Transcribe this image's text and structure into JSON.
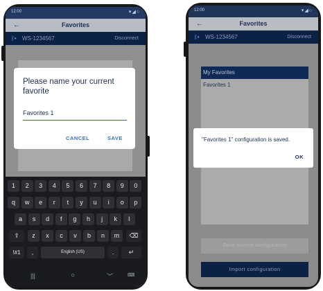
{
  "status": {
    "time": "12:00",
    "icons": "▾◢○"
  },
  "left": {
    "title": "Favorites",
    "device_id": "WS-1234567",
    "disconnect": "Disconnect",
    "dialog": {
      "title": "Please name your current favorite",
      "input_value": "Favorites 1",
      "cancel": "CANCEL",
      "save": "SAVE"
    },
    "keyboard": {
      "numbers": [
        "1",
        "2",
        "3",
        "4",
        "5",
        "6",
        "7",
        "8",
        "9",
        "0"
      ],
      "row1": [
        "q",
        "w",
        "e",
        "r",
        "t",
        "y",
        "u",
        "i",
        "o",
        "p"
      ],
      "row2": [
        "a",
        "s",
        "d",
        "f",
        "g",
        "h",
        "j",
        "k",
        "l"
      ],
      "row3": [
        "z",
        "x",
        "c",
        "v",
        "b",
        "n",
        "m"
      ],
      "symbols": "!#1",
      "comma": ",",
      "space": "English (US)",
      "period": "."
    }
  },
  "right": {
    "title": "Favorites",
    "device_id": "WS-1234567",
    "disconnect": "Disconnect",
    "list_header": "My Favorites",
    "list_item": "Favorites 1",
    "dialog": {
      "message": "\"Favorites 1\" configuration is saved.",
      "ok": "OK"
    },
    "save_config": "Save current configuration",
    "import_config": "Import configuration"
  }
}
